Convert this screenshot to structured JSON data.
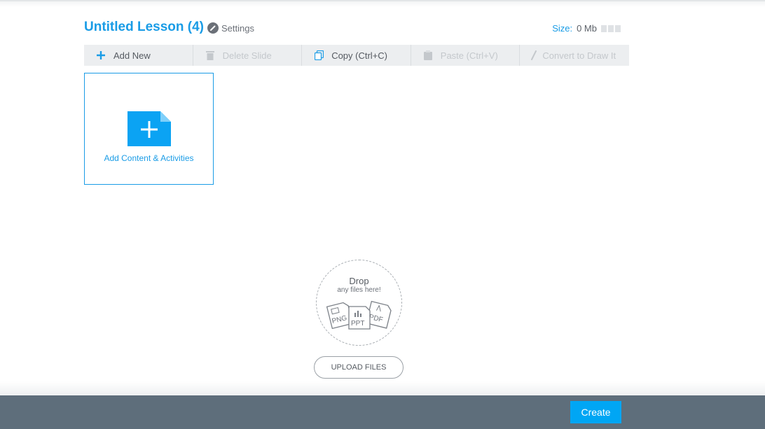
{
  "header": {
    "title": "Untitled Lesson (4)",
    "settings_label": "Settings",
    "size_label": "Size:",
    "size_value": "0 Mb"
  },
  "toolbar": {
    "add_new": "Add New",
    "delete_slide": "Delete Slide",
    "copy": "Copy (Ctrl+C)",
    "paste": "Paste (Ctrl+V)",
    "convert": "Convert to Draw It"
  },
  "add_card": {
    "label": "Add Content & Activities"
  },
  "drop_zone": {
    "title": "Drop",
    "subtitle": "any files here!",
    "file_types": [
      "PNG",
      "PPT",
      "PDF"
    ]
  },
  "upload_button": "UPLOAD FILES",
  "footer": {
    "create_label": "Create"
  },
  "colors": {
    "accent": "#1a9ce6",
    "create_button": "#00a6f4",
    "footer": "#5e6e7b",
    "toolbar": "#eceef0"
  }
}
